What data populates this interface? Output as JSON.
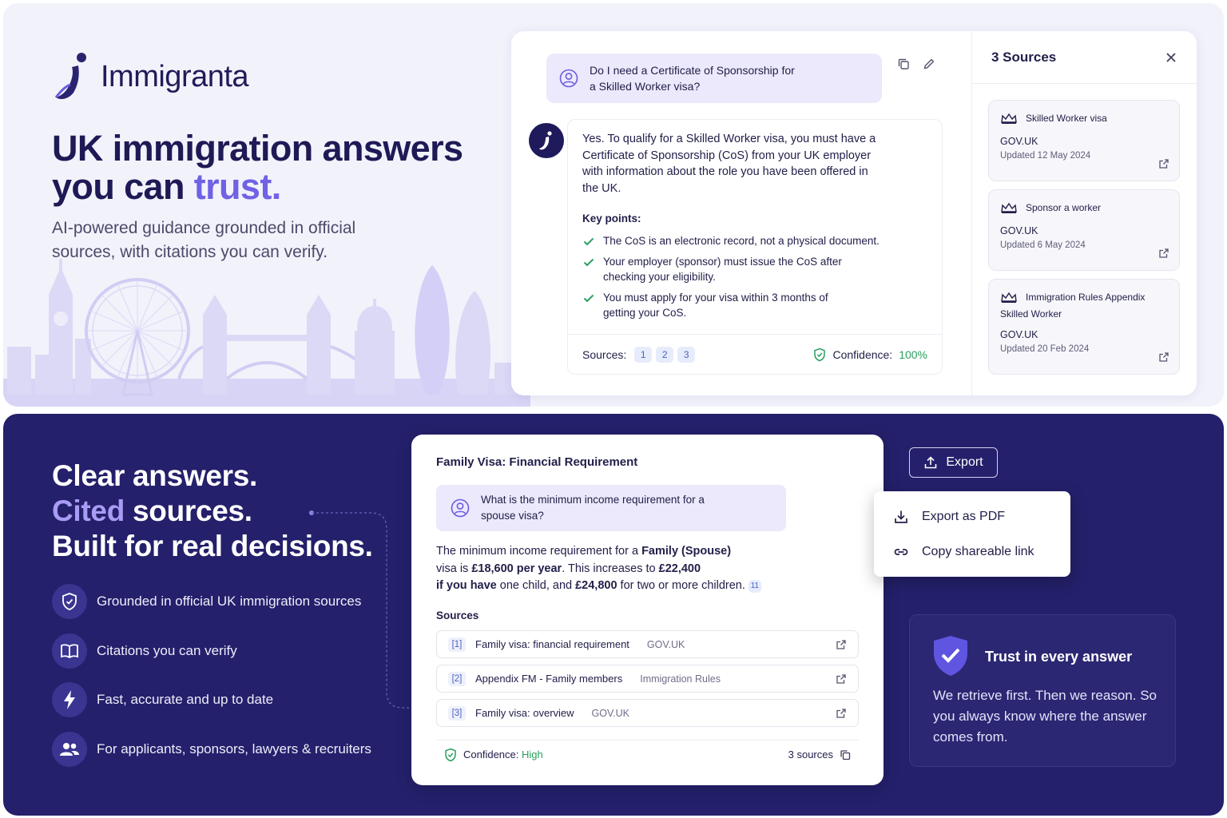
{
  "brand": {
    "name": "Immigranta"
  },
  "hero": {
    "title_line1": "UK immigration answers",
    "title_line2_prefix": "you can ",
    "title_line2_accent": "trust.",
    "subtitle": "AI-powered guidance grounded in official sources, with citations you can verify."
  },
  "chat": {
    "question": "Do I need a Certificate of Sponsorship for a Skilled Worker visa?",
    "answer": "Yes. To qualify for a Skilled Worker visa, you must have a Certificate of Sponsorship (CoS) from your UK employer with information about the role you have been offered in the UK.",
    "key_points_title": "Key points:",
    "key_points": [
      "The CoS is an electronic record, not a physical document.",
      "Your employer (sponsor) must issue the CoS after checking your eligibility.",
      "You must apply for your visa within 3 months of getting your CoS."
    ],
    "sources_label": "Sources:",
    "source_chips": [
      "1",
      "2",
      "3"
    ],
    "confidence_label": "Confidence:",
    "confidence_value": "100%"
  },
  "sources_panel": {
    "title": "3 Sources",
    "items": [
      {
        "title": "Skilled Worker visa",
        "title2": "",
        "org": "GOV.UK",
        "updated": "Updated 12 May 2024"
      },
      {
        "title": "Sponsor a worker",
        "title2": "",
        "org": "GOV.UK",
        "updated": "Updated 6 May 2024"
      },
      {
        "title": "Immigration Rules Appendix",
        "title2": "Skilled Worker",
        "org": "GOV.UK",
        "updated": "Updated 20 Feb 2024"
      }
    ]
  },
  "bottom": {
    "title_line1": "Clear answers.",
    "title_line2_accent": "Cited",
    "title_line2_rest": " sources.",
    "title_line3": "Built for real decisions.",
    "features": [
      {
        "icon": "shield-icon",
        "label": "Grounded in official UK immigration sources"
      },
      {
        "icon": "book-icon",
        "label": "Citations you can verify"
      },
      {
        "icon": "lightning-icon",
        "label": "Fast, accurate and up to date"
      },
      {
        "icon": "people-icon",
        "label": "For applicants, sponsors, lawyers & recruiters"
      }
    ]
  },
  "family": {
    "title": "Family Visa: Financial Requirement",
    "question": "What is the minimum income requirement for a spouse visa?",
    "answer_parts": {
      "p1": "The minimum income requirement for a ",
      "b1": "Family (Spouse)",
      "p2": "visa is ",
      "b2": "£18,600 per year",
      "p3": ". This increases to ",
      "b3": "£22,400",
      "p4": "if you have",
      "p5": " one child, and ",
      "b4": "£24,800",
      "p6": " for two or more children.",
      "chip": "11"
    },
    "sources_label": "Sources",
    "sources": [
      {
        "num": "[1]",
        "name": "Family visa: financial requirement",
        "org": "GOV.UK"
      },
      {
        "num": "[2]",
        "name": "Appendix FM - Family members",
        "org": "Immigration Rules"
      },
      {
        "num": "[3]",
        "name": "Family visa: overview",
        "org": "GOV.UK"
      }
    ],
    "confidence_label": "Confidence: ",
    "confidence_value": "High",
    "sources_count": "3 sources"
  },
  "export": {
    "button_label": "Export",
    "menu": [
      "Export as PDF",
      "Copy shareable link"
    ]
  },
  "trust": {
    "title": "Trust in every answer",
    "text": "We retrieve first. Then we reason. So you always know where the answer comes from."
  },
  "colors": {
    "navy": "#24206b",
    "accent": "#7062e4",
    "accent_light": "#a99cf5",
    "success": "#2aa060",
    "bubble": "#ebe9fb"
  }
}
